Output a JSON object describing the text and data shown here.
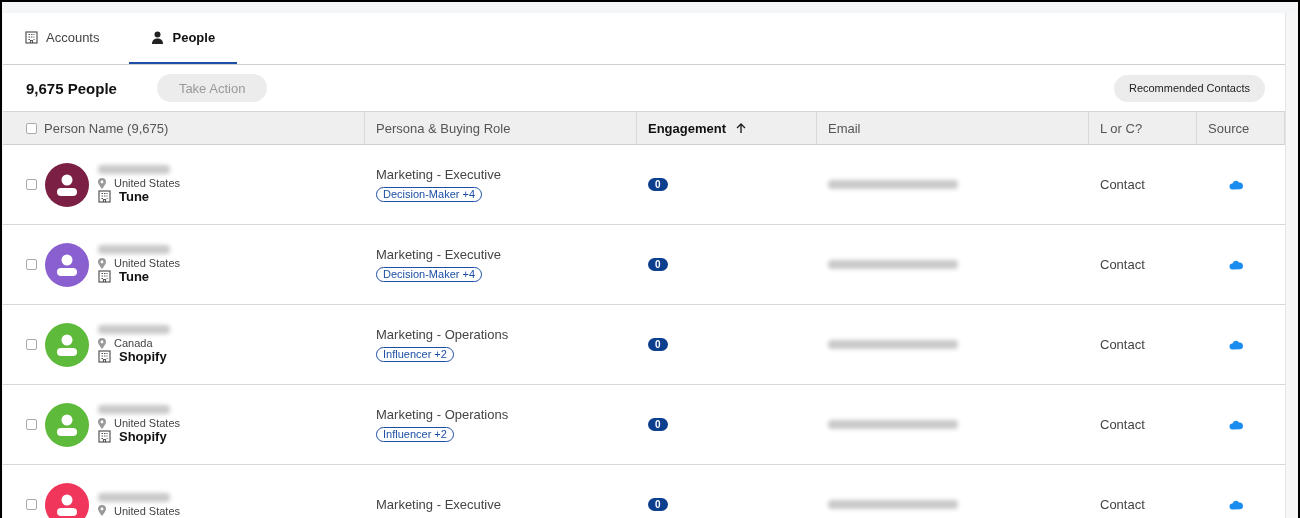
{
  "tabs": [
    {
      "label": "Accounts",
      "selected": false
    },
    {
      "label": "People",
      "selected": true
    }
  ],
  "toolbar": {
    "count": "9,675 People",
    "action_button": "Take Action",
    "action_disabled": true,
    "recommend_button": "Recommended Contacts"
  },
  "table": {
    "select_all_checked": false,
    "columns": [
      {
        "label": "Person Name (9,675)",
        "sorted": false
      },
      {
        "label": "Persona & Buying Role",
        "sorted": false
      },
      {
        "label": "Engagement",
        "sorted": true
      },
      {
        "label": "Email",
        "sorted": false
      },
      {
        "label": "L or C?",
        "sorted": false
      },
      {
        "label": "Source",
        "sorted": false
      }
    ],
    "rows": [
      {
        "checked": false,
        "color": "#7b1f45",
        "country": "United States",
        "company": "Tune",
        "persona": "Marketing - Executive",
        "role": "Decision-Maker +4",
        "engagement": "0",
        "type": "Contact"
      },
      {
        "checked": false,
        "color": "#8a5fcf",
        "country": "United States",
        "company": "Tune",
        "persona": "Marketing - Executive",
        "role": "Decision-Maker +4",
        "engagement": "0",
        "type": "Contact"
      },
      {
        "checked": false,
        "color": "#5dba3b",
        "country": "Canada",
        "company": "Shopify",
        "persona": "Marketing - Operations",
        "role": "Influencer +2",
        "engagement": "0",
        "type": "Contact"
      },
      {
        "checked": false,
        "color": "#5dba3b",
        "country": "United States",
        "company": "Shopify",
        "persona": "Marketing - Operations",
        "role": "Influencer +2",
        "engagement": "0",
        "type": "Contact"
      },
      {
        "checked": false,
        "color": "#f0365a",
        "country": "United States",
        "persona": "Marketing - Executive",
        "engagement": "0",
        "type": "Contact"
      }
    ]
  }
}
